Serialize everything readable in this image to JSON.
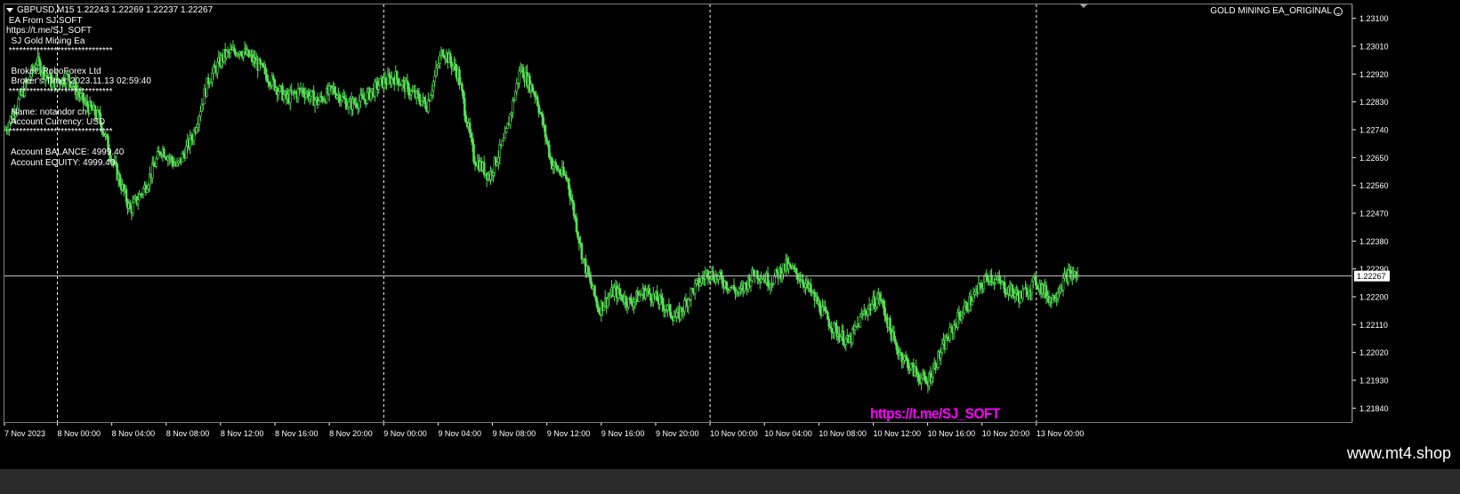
{
  "header": {
    "symbol_line": "GBPUSD,M15  1.22243 1.22269 1.22237 1.22267",
    "ea_name": "GOLD MINING EA_ORIGINAL"
  },
  "info_panel": {
    "lines": [
      " EA From SJ SOFT",
      "https://t.me/SJ_SOFT",
      "  SJ Gold Mining Ea",
      " ******************************",
      "",
      "  Broker: RoboForex Ltd",
      "  Broker's Time: 2023.11.13 02:59:40",
      " ******************************",
      "",
      "  Name: notandor cn",
      "  Account Currency: USD",
      " ******************************",
      "",
      "  Account BALANCE: 4999.40",
      "  Account EQUITY: 4999.40"
    ]
  },
  "overlay": {
    "telegram": "https://t.me/SJ_SOFT"
  },
  "watermark": "www.mt4.shop",
  "colors": {
    "background": "#000000",
    "candles": "#55e055",
    "grid": "#ffffff",
    "link": "#ff00ff",
    "current_price_bg": "#ffffff"
  },
  "chart_data": {
    "type": "candlestick",
    "symbol": "GBPUSD",
    "timeframe": "M15",
    "current_price": 1.22267,
    "ylim": [
      1.21795,
      1.23145
    ],
    "price_ticks": [
      "1.23100",
      "1.23010",
      "1.22920",
      "1.22830",
      "1.22740",
      "1.22650",
      "1.22560",
      "1.22470",
      "1.22380",
      "1.22290",
      "1.22200",
      "1.22110",
      "1.22020",
      "1.21930",
      "1.21840"
    ],
    "time_ticks": [
      "7 Nov 2023",
      "8 Nov 00:00",
      "8 Nov 04:00",
      "8 Nov 08:00",
      "8 Nov 12:00",
      "8 Nov 16:00",
      "8 Nov 20:00",
      "9 Nov 00:00",
      "9 Nov 04:00",
      "9 Nov 08:00",
      "9 Nov 12:00",
      "9 Nov 16:00",
      "9 Nov 20:00",
      "10 Nov 00:00",
      "10 Nov 04:00",
      "10 Nov 08:00",
      "10 Nov 12:00",
      "10 Nov 16:00",
      "10 Nov 20:00",
      "13 Nov 00:00"
    ],
    "day_separators": [
      "8 Nov 00:00",
      "9 Nov 00:00",
      "10 Nov 00:00",
      "13 Nov 00:00"
    ],
    "price_path": [
      [
        0,
        1.2274
      ],
      [
        3,
        1.2285
      ],
      [
        6,
        1.2296
      ],
      [
        9,
        1.2289
      ],
      [
        12,
        1.2291
      ],
      [
        15,
        1.2283
      ],
      [
        18,
        1.2278
      ],
      [
        21,
        1.2262
      ],
      [
        24,
        1.2248
      ],
      [
        27,
        1.2256
      ],
      [
        30,
        1.2268
      ],
      [
        33,
        1.2262
      ],
      [
        36,
        1.2272
      ],
      [
        39,
        1.229
      ],
      [
        42,
        1.2298
      ],
      [
        45,
        1.23
      ],
      [
        48,
        1.2296
      ],
      [
        51,
        1.229
      ],
      [
        54,
        1.2284
      ],
      [
        57,
        1.2287
      ],
      [
        60,
        1.2283
      ],
      [
        63,
        1.2287
      ],
      [
        66,
        1.2282
      ],
      [
        69,
        1.2284
      ],
      [
        72,
        1.2289
      ],
      [
        75,
        1.2291
      ],
      [
        78,
        1.2286
      ],
      [
        81,
        1.2282
      ],
      [
        84,
        1.23
      ],
      [
        87,
        1.2292
      ],
      [
        90,
        1.2265
      ],
      [
        93,
        1.2259
      ],
      [
        96,
        1.2271
      ],
      [
        99,
        1.2294
      ],
      [
        102,
        1.2285
      ],
      [
        105,
        1.2263
      ],
      [
        108,
        1.2258
      ],
      [
        111,
        1.2232
      ],
      [
        114,
        1.2216
      ],
      [
        117,
        1.2222
      ],
      [
        120,
        1.2218
      ],
      [
        123,
        1.2222
      ],
      [
        126,
        1.2218
      ],
      [
        129,
        1.2213
      ],
      [
        132,
        1.2222
      ],
      [
        135,
        1.2228
      ],
      [
        138,
        1.2225
      ],
      [
        141,
        1.2221
      ],
      [
        144,
        1.2228
      ],
      [
        147,
        1.2225
      ],
      [
        150,
        1.223
      ],
      [
        153,
        1.2226
      ],
      [
        156,
        1.2218
      ],
      [
        159,
        1.221
      ],
      [
        162,
        1.2205
      ],
      [
        165,
        1.2215
      ],
      [
        168,
        1.222
      ],
      [
        171,
        1.2204
      ],
      [
        174,
        1.2197
      ],
      [
        177,
        1.2192
      ],
      [
        180,
        1.2203
      ],
      [
        183,
        1.2213
      ],
      [
        186,
        1.222
      ],
      [
        189,
        1.2227
      ],
      [
        192,
        1.2223
      ],
      [
        195,
        1.222
      ],
      [
        198,
        1.2225
      ],
      [
        201,
        1.2219
      ],
      [
        204,
        1.2227
      ],
      [
        206,
        1.2227
      ]
    ]
  }
}
